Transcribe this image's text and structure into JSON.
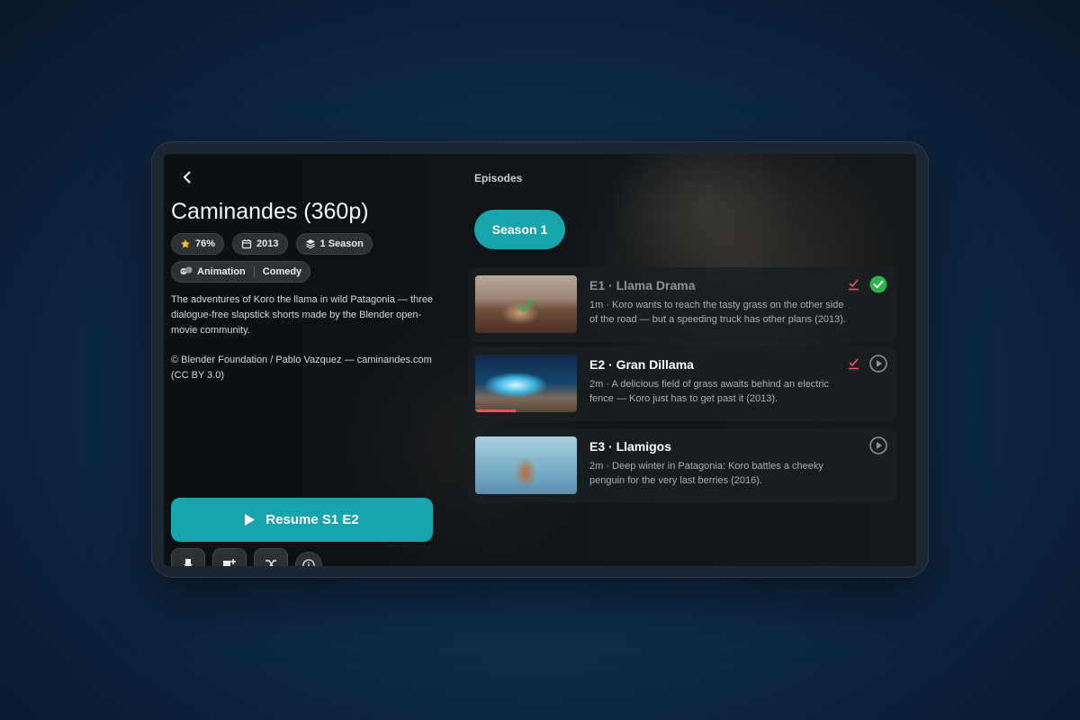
{
  "show": {
    "title": "Caminandes (360p)",
    "rating": "76%",
    "year": "2013",
    "seasons": "1 Season",
    "genres": [
      "Animation",
      "Comedy"
    ],
    "description": "The adventures of Koro the llama in wild Patagonia — three dialogue-free slapstick shorts made by the Blender open-movie community.",
    "credit": "© Blender Foundation / Pablo Vazquez — caminandes.com (CC BY 3.0)"
  },
  "actions": {
    "resume_label": "Resume S1 E2"
  },
  "episodes_panel": {
    "label": "Episodes",
    "season_button": "Season 1",
    "items": [
      {
        "title": "E1 · Llama Drama",
        "description": "1m · Koro wants to reach the tasty grass on the other side of the road — but a speeding truck has other plans (2013).",
        "watched": true,
        "progress": 1.0
      },
      {
        "title": "E2 · Gran Dillama",
        "description": "2m · A delicious field of grass awaits behind an electric fence — Koro just has to get past it (2013).",
        "watched": false,
        "progress": 0.4
      },
      {
        "title": "E3 · Llamigos",
        "description": "2m · Deep winter in Patagonia: Koro battles a cheeky penguin for the very last berries (2016).",
        "watched": false,
        "progress": 0
      }
    ]
  },
  "colors": {
    "accent": "#17a4ad",
    "watched_check": "#2bb24c",
    "progress": "#ff4d5e",
    "star": "#f4c430"
  },
  "icons": [
    "back-arrow-icon",
    "star-icon",
    "calendar-icon",
    "layers-icon",
    "theater-masks-icon",
    "play-icon",
    "check-icon",
    "mark-watched-icon",
    "play-circle-icon"
  ]
}
